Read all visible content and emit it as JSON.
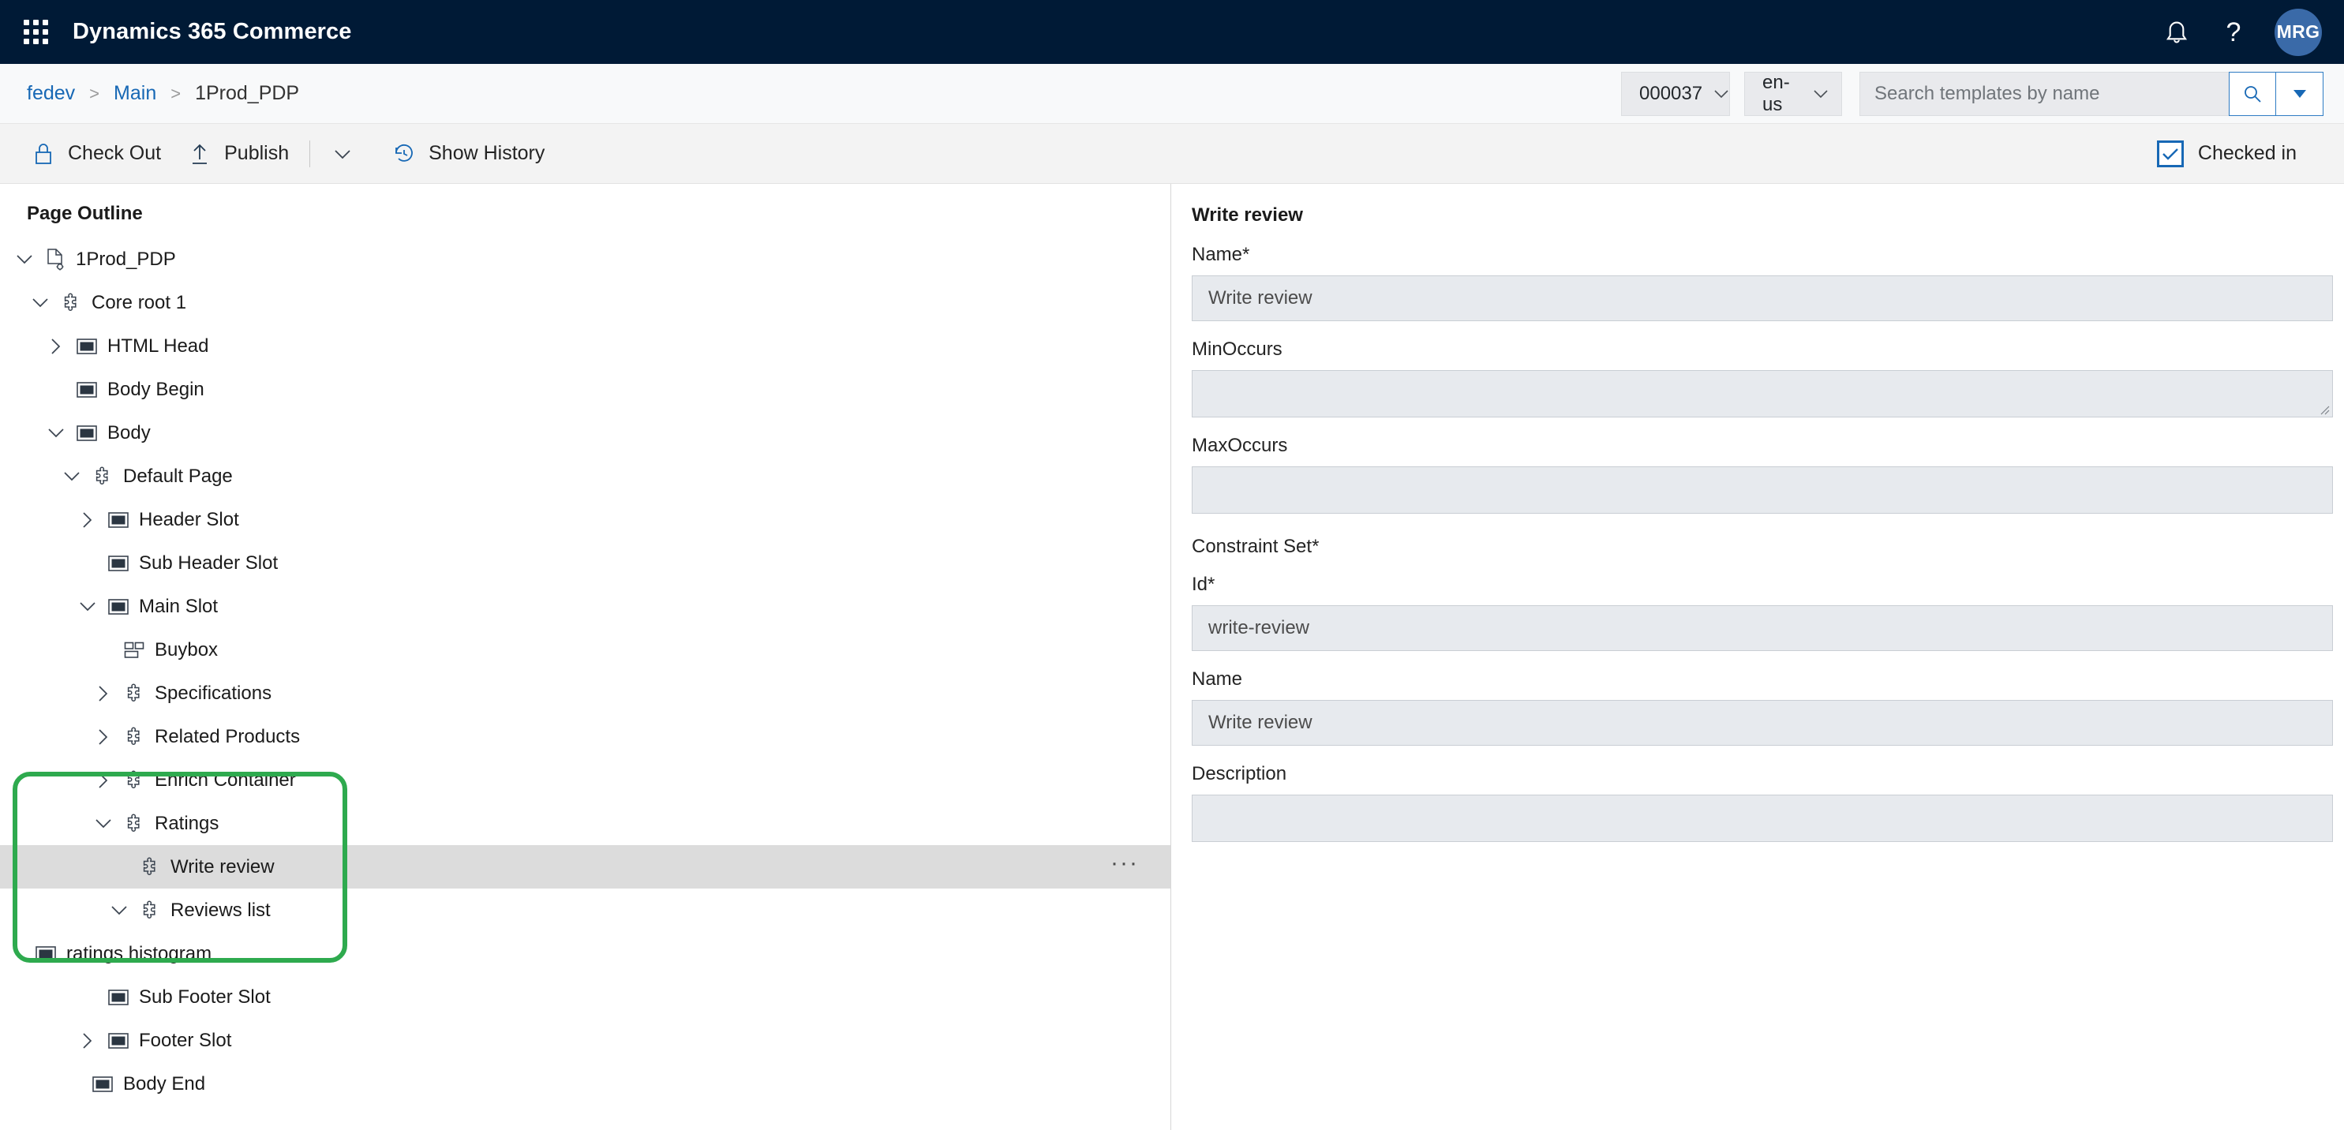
{
  "header": {
    "app_title": "Dynamics 365 Commerce",
    "waffle_icon": "waffle-grid-icon",
    "notifications_icon": "bell-icon",
    "help_icon": "question-mark-icon",
    "avatar_initials": "MRG",
    "accent_color": "#001a36",
    "avatar_color": "#3a6aa8"
  },
  "breadcrumb": {
    "items": [
      {
        "label": "fedev",
        "is_link": true
      },
      {
        "label": "Main",
        "is_link": true
      },
      {
        "label": "1Prod_PDP",
        "is_link": false
      }
    ],
    "separator": ">"
  },
  "toolbar_right": {
    "store_dropdown": {
      "value": "000037",
      "icon": "chevron-down-icon"
    },
    "locale_dropdown": {
      "value": "en-us",
      "icon": "chevron-down-icon"
    },
    "search": {
      "value": "",
      "placeholder": "Search templates by name",
      "search_icon": "search-icon",
      "dropdown_icon": "caret-down-icon"
    }
  },
  "commandbar": {
    "check_out": {
      "label": "Check Out",
      "icon": "lock-icon"
    },
    "publish": {
      "label": "Publish",
      "icon": "upload-icon"
    },
    "publish_more": {
      "icon": "chevron-down-icon"
    },
    "show_history": {
      "label": "Show History",
      "icon": "history-clock-icon"
    },
    "status": {
      "label": "Checked in",
      "icon": "checkbox-checked-icon",
      "color": "#1768b5"
    }
  },
  "outline": {
    "title": "Page Outline",
    "nodes": [
      {
        "label": "1Prod_PDP",
        "depth": 0,
        "twisty": "expanded",
        "icon": "page-settings-icon",
        "selected": false
      },
      {
        "label": "Core root 1",
        "depth": 1,
        "twisty": "expanded",
        "icon": "puzzle-piece-icon",
        "selected": false
      },
      {
        "label": "HTML Head",
        "depth": 2,
        "twisty": "collapsed",
        "icon": "slot-module-icon",
        "selected": false
      },
      {
        "label": "Body Begin",
        "depth": 2,
        "twisty": "none",
        "icon": "slot-module-icon",
        "selected": false
      },
      {
        "label": "Body",
        "depth": 2,
        "twisty": "expanded",
        "icon": "slot-module-icon",
        "selected": false
      },
      {
        "label": "Default Page",
        "depth": 3,
        "twisty": "expanded",
        "icon": "puzzle-piece-icon",
        "selected": false
      },
      {
        "label": "Header Slot",
        "depth": 4,
        "twisty": "collapsed",
        "icon": "slot-module-icon",
        "selected": false
      },
      {
        "label": "Sub Header Slot",
        "depth": 4,
        "twisty": "none",
        "icon": "slot-module-icon",
        "selected": false
      },
      {
        "label": "Main Slot",
        "depth": 4,
        "twisty": "expanded",
        "icon": "slot-module-icon",
        "selected": false
      },
      {
        "label": "Buybox",
        "depth": 5,
        "twisty": "none",
        "icon": "layout-module-icon",
        "selected": false
      },
      {
        "label": "Specifications",
        "depth": 5,
        "twisty": "collapsed",
        "icon": "puzzle-piece-icon",
        "selected": false
      },
      {
        "label": "Related Products",
        "depth": 5,
        "twisty": "collapsed",
        "icon": "puzzle-piece-icon",
        "selected": false
      },
      {
        "label": "Enrich Container",
        "depth": 5,
        "twisty": "collapsed",
        "icon": "puzzle-piece-icon",
        "selected": false
      },
      {
        "label": "Ratings",
        "depth": 5,
        "twisty": "expanded",
        "icon": "puzzle-piece-icon",
        "selected": false
      },
      {
        "label": "Write review",
        "depth": 6,
        "twisty": "none",
        "icon": "puzzle-piece-icon",
        "selected": true,
        "overflow": "···"
      },
      {
        "label": "Reviews list",
        "depth": 6,
        "twisty": "expanded",
        "icon": "puzzle-piece-icon",
        "selected": false
      },
      {
        "label": "ratings histogram",
        "depth": 7,
        "twisty": "none",
        "icon": "slot-module-icon",
        "selected": false
      },
      {
        "label": "Sub Footer Slot",
        "depth": 4,
        "twisty": "none",
        "icon": "slot-module-icon",
        "selected": false
      },
      {
        "label": "Footer Slot",
        "depth": 4,
        "twisty": "collapsed",
        "icon": "slot-module-icon",
        "selected": false
      },
      {
        "label": "Body End",
        "depth": 3,
        "twisty": "none",
        "icon": "slot-module-icon",
        "selected": false
      }
    ],
    "annotation": {
      "color": "#2eaa4e",
      "shape": "rounded-rectangle"
    }
  },
  "properties": {
    "title": "Write review",
    "fields": [
      {
        "label": "Name*",
        "value": "Write review",
        "empty": false
      },
      {
        "label": "MinOccurs",
        "value": "",
        "empty": true
      },
      {
        "label": "MaxOccurs",
        "value": "",
        "empty": true
      }
    ],
    "constraint_section": "Constraint Set*",
    "constraint_fields": [
      {
        "label": "Id*",
        "value": "write-review",
        "empty": false
      },
      {
        "label": "Name",
        "value": "Write review",
        "empty": false
      },
      {
        "label": "Description",
        "value": "",
        "empty": true
      }
    ]
  }
}
